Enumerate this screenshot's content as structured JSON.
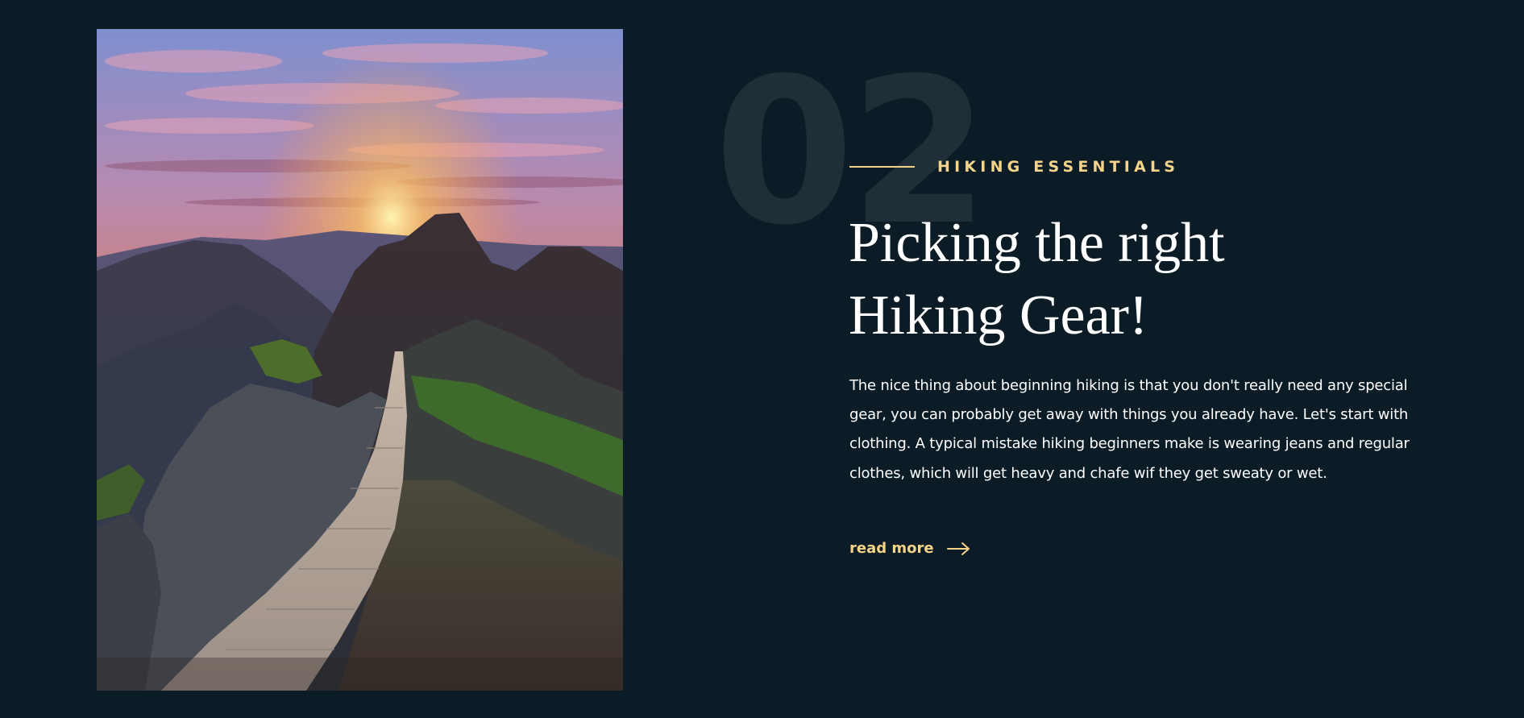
{
  "section": {
    "number": "02",
    "eyebrow": "HIKING ESSENTIALS",
    "title_line1": "Picking the right",
    "title_line2": "Hiking Gear!",
    "body": "The nice thing about beginning hiking is that you don't really need any special gear, you can probably get away with things you already have. Let's start with clothing. A typical mistake hiking beginners make is wearing jeans and regular clothes, which will get heavy and chafe wif they get sweaty or wet.",
    "read_more_label": "read more"
  },
  "icons": {
    "read_more": "arrow-right-icon"
  },
  "colors": {
    "background": "#0b1c26",
    "accent": "#f5d48a",
    "number": "#1f2e37",
    "text": "#ffffff"
  }
}
